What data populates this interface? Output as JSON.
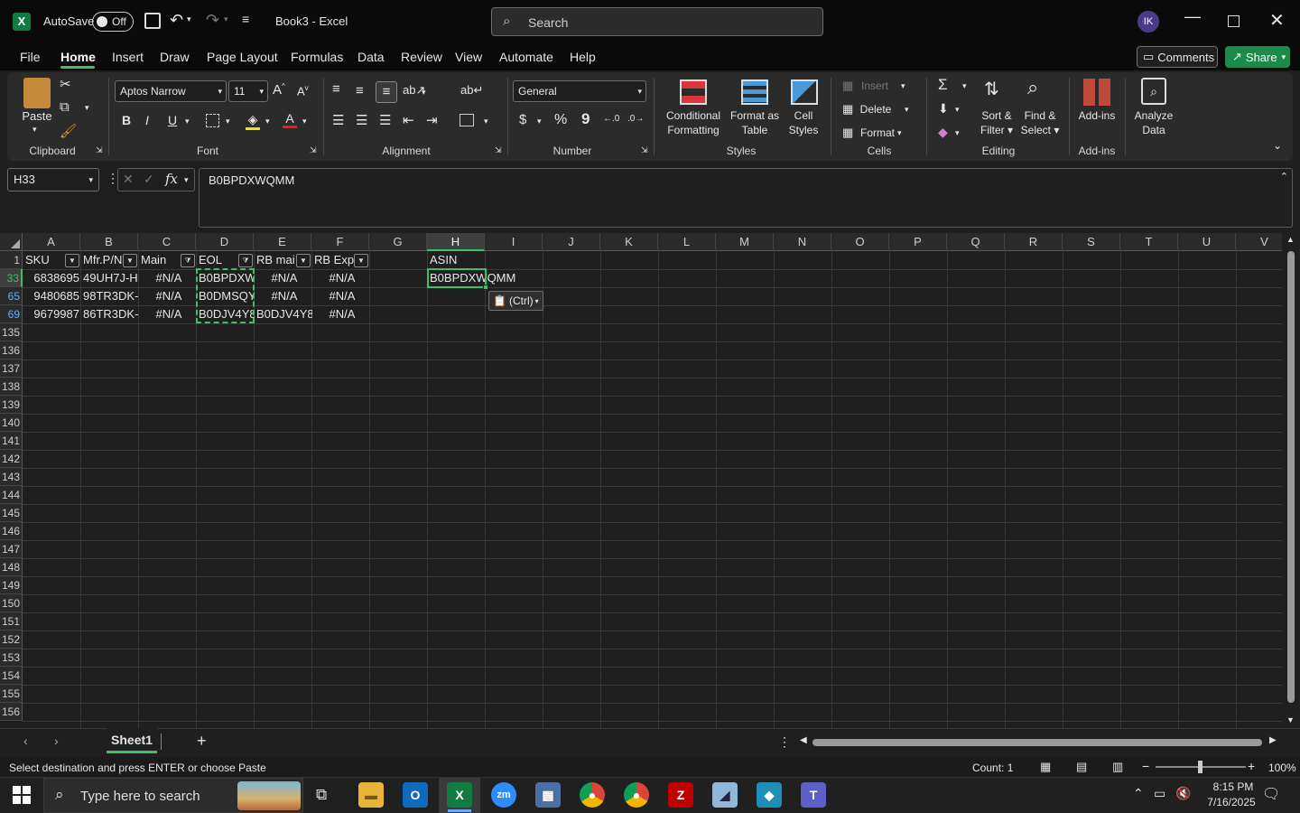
{
  "titlebar": {
    "autosave": "AutoSave",
    "toggle": "Off",
    "doc_title": "Book3 - Excel",
    "search_placeholder": "Search",
    "avatar": "IK"
  },
  "tabs": [
    "File",
    "Home",
    "Insert",
    "Draw",
    "Page Layout",
    "Formulas",
    "Data",
    "Review",
    "View",
    "Automate",
    "Help"
  ],
  "actions": {
    "comments": "Comments",
    "share": "Share"
  },
  "ribbon": {
    "paste": "Paste",
    "clipboard": "Clipboard",
    "font_name": "Aptos Narrow",
    "font_size": "11",
    "font": "Font",
    "alignment": "Alignment",
    "number_format": "General",
    "number": "Number",
    "cond_fmt_1": "Conditional",
    "cond_fmt_2": "Formatting",
    "fmt_table_1": "Format as",
    "fmt_table_2": "Table",
    "cell_styles_1": "Cell",
    "cell_styles_2": "Styles",
    "styles": "Styles",
    "insert": "Insert",
    "delete": "Delete",
    "format": "Format",
    "cells": "Cells",
    "sort_1": "Sort &",
    "sort_2": "Filter",
    "find_1": "Find &",
    "find_2": "Select",
    "editing": "Editing",
    "addins_btn": "Add-ins",
    "addins": "Add-ins",
    "analyze_1": "Analyze",
    "analyze_2": "Data"
  },
  "formula": {
    "namebox": "H33",
    "value": "B0BPDXWQMM",
    "fx": "fx"
  },
  "columns": [
    "A",
    "B",
    "C",
    "D",
    "E",
    "F",
    "G",
    "H",
    "I",
    "J",
    "K",
    "L",
    "M",
    "N",
    "O",
    "P",
    "Q",
    "R",
    "S",
    "T",
    "U",
    "V"
  ],
  "rows": [
    "1",
    "33",
    "65",
    "69",
    "135",
    "136",
    "137",
    "138",
    "139",
    "140",
    "141",
    "142",
    "143",
    "144",
    "145",
    "146",
    "147",
    "148",
    "149",
    "150",
    "151",
    "152",
    "153",
    "154",
    "155",
    "156"
  ],
  "headers": {
    "a": "SKU",
    "b": "Mfr.P/N",
    "c": "Main",
    "d": "EOL",
    "e": "RB mai",
    "f": "RB Exp",
    "h": "ASIN"
  },
  "data": [
    {
      "a": "6838695",
      "b": "49UH7J-H",
      "c": "#N/A",
      "d": "B0BPDXW",
      "e": "#N/A",
      "f": "#N/A",
      "h": "B0BPDXWQMM"
    },
    {
      "a": "9480685",
      "b": "98TR3DK-I",
      "c": "#N/A",
      "d": "B0DMSQY",
      "e": "#N/A",
      "f": "#N/A"
    },
    {
      "a": "9679987",
      "b": "86TR3DK-I",
      "c": "#N/A",
      "d": "B0DJV4Y8",
      "e": "B0DJV4Y8",
      "f": "#N/A"
    }
  ],
  "paste_options": "(Ctrl)",
  "sheet": {
    "name": "Sheet1",
    "add": "+"
  },
  "status": {
    "message": "Select destination and press ENTER or choose Paste",
    "count": "Count: 1",
    "zoom": "100%"
  },
  "taskbar": {
    "search": "Type here to search",
    "time": "8:15 PM",
    "date": "7/16/2025"
  }
}
